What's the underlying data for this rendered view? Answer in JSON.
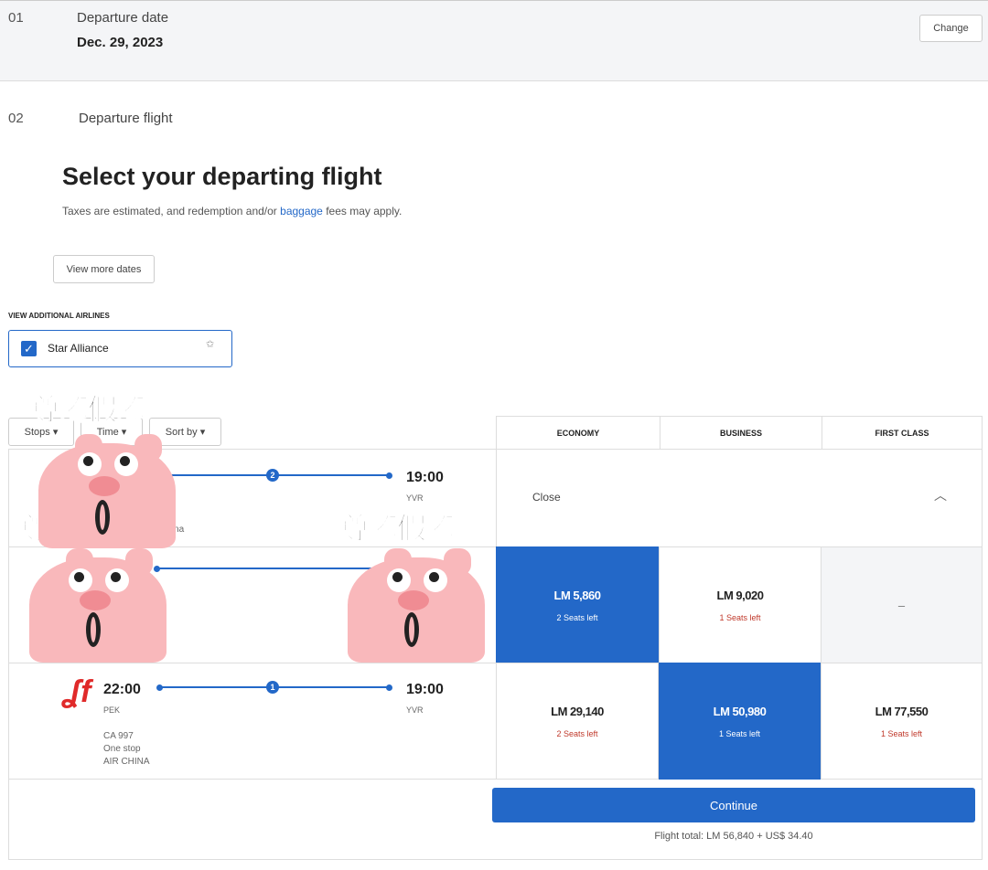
{
  "step1": {
    "number": "01",
    "label": "Departure date",
    "value": "Dec. 29, 2023",
    "change_label": "Change"
  },
  "step2": {
    "number": "02",
    "label": "Departure flight"
  },
  "main": {
    "title": "Select your departing flight",
    "subtitle_pre": "Taxes are estimated, and redemption and/or ",
    "subtitle_link": "baggage",
    "subtitle_post": " fees may apply.",
    "view_more_dates": "View more dates"
  },
  "airlines": {
    "heading": "VIEW ADDITIONAL AIRLINES",
    "option": "Star Alliance",
    "checked": true
  },
  "filters": [
    {
      "label": "Stops"
    },
    {
      "label": "Time"
    },
    {
      "label": "Sort by"
    }
  ],
  "columns": [
    "ECONOMY",
    "BUSINESS",
    "FIRST CLASS"
  ],
  "flights": [
    {
      "arrive_time": "19:00",
      "arrive_code": "YVR",
      "stops": "2",
      "details_partial": [
        "m",
        "China"
      ],
      "close_label": "Close"
    },
    {
      "fares": [
        {
          "price": "LM 5,860",
          "seats": "2 Seats left",
          "selected": true
        },
        {
          "price": "LM 9,020",
          "seats": "1 Seats left"
        },
        {
          "price": "–",
          "unavailable": true
        }
      ]
    },
    {
      "depart_time": "22:00",
      "depart_code": "PEK",
      "arrive_time": "19:00",
      "arrive_code": "YVR",
      "stops": "1",
      "flight_no": "CA 997",
      "stop_text": "One stop",
      "airline": "AIR CHINA",
      "fares": [
        {
          "price": "LM 29,140",
          "seats": "2 Seats left"
        },
        {
          "price": "LM 50,980",
          "seats": "1 Seats left",
          "selected": true
        },
        {
          "price": "LM 77,550",
          "seats": "1 Seats left"
        }
      ]
    }
  ],
  "footer": {
    "continue_label": "Continue",
    "total": "Flight total: LM 56,840 + US$ 34.40"
  },
  "stickers": {
    "text": "尊嘟假嘟"
  },
  "colors": {
    "accent": "#2368c8",
    "warning": "#c0392b",
    "logo": "#e02a2a"
  }
}
